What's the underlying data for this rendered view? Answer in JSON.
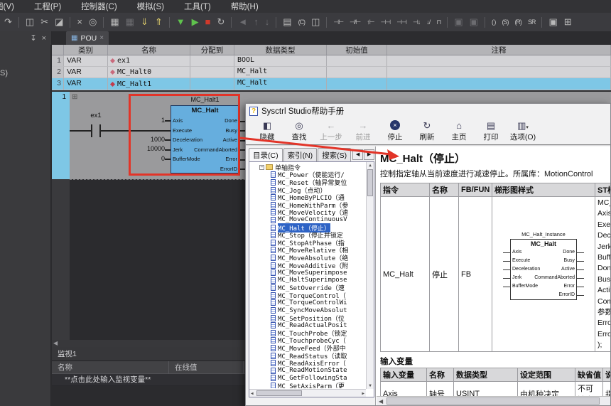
{
  "menu": {
    "items": [
      "图(V)",
      "工程(P)",
      "控制器(C)",
      "模拟(S)",
      "工具(T)",
      "帮助(H)"
    ]
  },
  "toolbar": {
    "icons": [
      {
        "n": "redo-icon",
        "g": "↷"
      },
      {
        "n": "copy-icon",
        "g": "◫"
      },
      {
        "n": "cut-icon",
        "g": "✂"
      },
      {
        "n": "paste-icon",
        "g": "◪"
      },
      {
        "n": "delete-icon",
        "g": "×"
      },
      {
        "n": "search-doc-icon",
        "g": "◎"
      },
      {
        "n": "grid-editor-icon",
        "g": "▦"
      },
      {
        "n": "grid-editor-2-icon",
        "g": "▦"
      },
      {
        "n": "transfer-download-icon",
        "g": "⇓"
      },
      {
        "n": "transfer-upload-icon",
        "g": "⇑"
      },
      {
        "n": "filter-icon",
        "g": "▼"
      },
      {
        "n": "run-icon",
        "g": "▶"
      },
      {
        "n": "stop-icon",
        "g": "■"
      },
      {
        "n": "rebuild-icon",
        "g": "↻"
      },
      {
        "n": "nav-back-icon",
        "g": "◄"
      },
      {
        "n": "move-up-icon",
        "g": "↑"
      },
      {
        "n": "move-down-icon",
        "g": "↓"
      },
      {
        "n": "io-settings-icon",
        "g": "▤"
      },
      {
        "n": "io-settings-2-icon",
        "g": "▥"
      },
      {
        "n": "comment-icon",
        "g": "(C)"
      },
      {
        "n": "split-view-icon",
        "g": "◫"
      },
      {
        "n": "open-contact-icon",
        "g": "⊣⊢"
      },
      {
        "n": "closed-contact-icon",
        "g": "⊣/⊢"
      },
      {
        "n": "rising-edge-contact-icon",
        "g": "↑⊢"
      },
      {
        "n": "parallel-contact-icon",
        "g": "⊣⊣"
      },
      {
        "n": "parallel-closed-contact-icon",
        "g": "⊣⊣"
      },
      {
        "n": "down-contact-icon",
        "g": "⊣↓"
      },
      {
        "n": "down-closed-contact-icon",
        "g": "↓/"
      },
      {
        "n": "edge-detect-contact-icon",
        "g": "⊓"
      },
      {
        "n": "inline-block-icon",
        "g": "▣"
      },
      {
        "n": "inline-block-2-icon",
        "g": "▣"
      },
      {
        "n": "coil-icon",
        "g": "( )"
      },
      {
        "n": "set-coil-icon",
        "g": "(S)"
      },
      {
        "n": "reset-coil-icon",
        "g": "(R)"
      },
      {
        "n": "sr-flipflop-icon",
        "g": "SR"
      },
      {
        "n": "fb-call-icon",
        "g": "▣"
      },
      {
        "n": "fun-call-icon",
        "g": "⊞"
      }
    ]
  },
  "dock": {
    "pin": "↧",
    "close": "×"
  },
  "sidebar": {
    "clipped": "S)"
  },
  "pou": {
    "icon": "▦",
    "label": "POU",
    "close": "×"
  },
  "var_table": {
    "headers": [
      "类别",
      "名称",
      "分配到",
      "数据类型",
      "初始值",
      "注释"
    ],
    "rows": [
      {
        "num": "1",
        "category": "VAR",
        "name": "ex1",
        "assigned": "",
        "datatype": "BOOL",
        "initial": "",
        "comment": ""
      },
      {
        "num": "2",
        "category": "VAR",
        "name": "MC_Halt0",
        "assigned": "",
        "datatype": "MC_Halt",
        "initial": "",
        "comment": ""
      },
      {
        "num": "3",
        "category": "VAR",
        "name": "MC_Halt1",
        "assigned": "",
        "datatype": "MC_Halt",
        "initial": "",
        "comment": ""
      }
    ]
  },
  "ladder": {
    "rung_number": "1",
    "expander": "⊞",
    "contact_label": "ex1",
    "instance_name": "MC_Halt1",
    "block_title": "MC_Halt",
    "inputs": [
      {
        "pin": "Axis",
        "value": "1"
      },
      {
        "pin": "Execute",
        "value": ""
      },
      {
        "pin": "Deceleration",
        "value": "1000"
      },
      {
        "pin": "Jerk",
        "value": "10000"
      },
      {
        "pin": "BufferMode",
        "value": "0"
      }
    ],
    "outputs": [
      "Done",
      "Busy",
      "Active",
      "CommandAborted",
      "Error",
      "ErrorID"
    ],
    "scroll_left": "◀"
  },
  "watch": {
    "title": "监视1",
    "headers": [
      "名称",
      "在线值"
    ],
    "placeholder": "**点击此处输入监视变量**"
  },
  "colors": {
    "selected_row": "#7ec7e6",
    "block_fill": "#66aede",
    "tree_selection": "#2e63c5",
    "annotation_red": "#e23428",
    "run_green": "#5fc24d",
    "stop_red": "#d0392b"
  },
  "help": {
    "title": "Sysctrl Studio帮助手册",
    "icon_glyph": "?",
    "toolbar": {
      "buttons": [
        {
          "glyph": "◧",
          "label": "隐藏"
        },
        {
          "glyph": "◎",
          "label": "查找"
        },
        {
          "glyph": "←",
          "label": "上一步"
        },
        {
          "glyph": "→",
          "label": "前进"
        },
        {
          "glyph": "×",
          "label": "停止"
        },
        {
          "glyph": "↻",
          "label": "刷新"
        },
        {
          "glyph": "⌂",
          "label": "主页"
        },
        {
          "glyph": "▤",
          "label": "打印"
        },
        {
          "glyph": "▥",
          "label": "选项(O)"
        }
      ],
      "options_caret": "▾"
    },
    "tabs": [
      "目录(C)",
      "索引(N)",
      "搜索(S)"
    ],
    "tab_nav": {
      "left": "◀",
      "right": "▶"
    },
    "tree": {
      "root": "单轴指令",
      "expander": "−",
      "items": [
        "MC_Power（使能运行/",
        "MC_Reset（轴异常复位",
        "MC_Jog（点动）",
        "MC_HomeByPLCIO（通",
        "MC_HomeWithParm（参",
        "MC_MoveVelocity（速",
        "MC_MoveContinuousV",
        "MC_Halt（停止）",
        "MC_Stop（停止并锁定",
        "MC_StopAtPhase（指",
        "MC_MoveRelative（相",
        "MC_MoveAbsolute（绝",
        "MC_MoveAdditive（附",
        "MC_MoveSuperimpose",
        "MC_HaltSuperimpose",
        "MC_SetOverride（速",
        "MC_TorqueControl（",
        "MC_TorqueControlWi",
        "MC_SyncMoveAbsolut",
        "MC_SetPosition（位",
        "MC_ReadActualPosit",
        "MC_TouchProbe（锁定",
        "MC_TouchprobeCyc（",
        "MC_MoveFeed（外部中",
        "MC_ReadStatus（读取",
        "MC_ReadAxisError（",
        "MC_ReadMotionState",
        "MC_GetFollowingSta",
        "MC_SetAxisParm（更",
        "MC_SetFollowingPar"
      ],
      "scroll": {
        "up": "▲",
        "down": "▼",
        "left": "◀",
        "right": "▶"
      }
    },
    "content": {
      "title": "MC_Halt（停止）",
      "description": "控制指定轴从当前速度进行减速停止。所属库：MotionControl",
      "table1": {
        "headers": [
          "指令",
          "名称",
          "FB/FUN",
          "梯形图样式",
          "ST样式"
        ],
        "row": {
          "instruction": "MC_Halt",
          "name": "停止",
          "fbfun": "FB"
        },
        "st_lines": [
          "MC_H",
          "Axis :",
          "Execu",
          "Decel",
          "Jerk:=",
          "Buffer",
          "Done=",
          "Busy=",
          "Active",
          "Comm",
          "参数",
          "Error",
          "ErrorI",
          ");"
        ]
      },
      "diagram": {
        "instance": "MC_Halt_Instance",
        "title": "MC_Halt",
        "inputs": [
          "Axis",
          "Execute",
          "Deceleration",
          "Jerk",
          "BufferMode"
        ],
        "outputs": [
          "Done",
          "Busy",
          "Active",
          "CommandAborted",
          "Error",
          "ErrorID"
        ]
      },
      "section2": "输入变量",
      "table2": {
        "headers": [
          "输入变量",
          "名称",
          "数据类型",
          "设定范围",
          "缺省值",
          "说明"
        ],
        "rows": [
          {
            "var": "Axis",
            "name": "轴号",
            "datatype": "USINT",
            "range": "由机种决定",
            "default": "不可缺省",
            "desc": "指定"
          }
        ]
      },
      "hscroll_left": "◀"
    }
  }
}
